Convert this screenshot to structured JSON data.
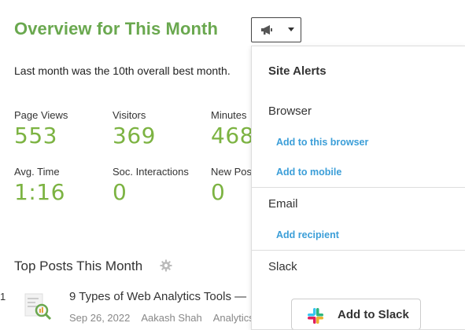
{
  "header": {
    "title": "Overview for This Month",
    "subtitle": "Last month was the 10th overall best month."
  },
  "stats": [
    {
      "label": "Page Views",
      "value": "553"
    },
    {
      "label": "Visitors",
      "value": "369"
    },
    {
      "label": "Minutes",
      "value": "468"
    },
    {
      "label": "Avg. Time",
      "value": "1:16"
    },
    {
      "label": "Soc. Interactions",
      "value": "0"
    },
    {
      "label": "New Pos",
      "value": "0"
    }
  ],
  "top_posts": {
    "heading": "Top Posts This Month",
    "items": [
      {
        "rank": "1",
        "title": "9 Types of Web Analytics Tools —",
        "date": "Sep 26, 2022",
        "author": "Aakash Shah",
        "category": "Analytics"
      }
    ]
  },
  "alerts_menu": {
    "heading": "Site Alerts",
    "browser": {
      "label": "Browser",
      "links": [
        "Add to this browser",
        "Add to mobile"
      ]
    },
    "email": {
      "label": "Email",
      "links": [
        "Add recipient"
      ]
    },
    "slack": {
      "label": "Slack",
      "button_label": "Add to Slack"
    }
  },
  "icons": {
    "alert_toggle": "megaphone-icon",
    "settings": "gear-icon",
    "slack": "slack-logo-icon"
  },
  "colors": {
    "accent_green": "#6aa84f",
    "value_green": "#7cb342",
    "link_blue": "#3b9ed8"
  }
}
